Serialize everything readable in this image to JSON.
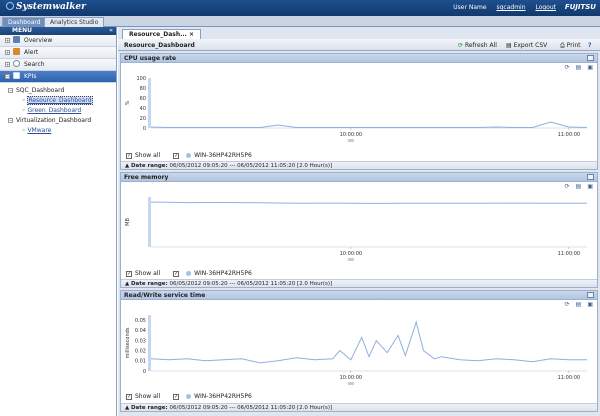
{
  "header": {
    "app_name": "Systemwalker",
    "user_label": "User Name",
    "user_name": "sqcadmin",
    "logout": "Logout",
    "vendor": "FUJITSU"
  },
  "top_tabs": [
    {
      "label": "Dashboard",
      "active": true
    },
    {
      "label": "Analytics Studio",
      "active": false
    }
  ],
  "menu": {
    "title": "MENU",
    "items": [
      {
        "label": "Overview",
        "icon": "overview-icon",
        "color": "#5b7fb5"
      },
      {
        "label": "Alert",
        "icon": "alert-icon",
        "color": "#d9892d"
      },
      {
        "label": "Search",
        "icon": "search-icon",
        "color": "#7a8a9a"
      },
      {
        "label": "KPIs",
        "icon": "kpi-icon",
        "color": "#2c6cc4"
      }
    ],
    "tree": [
      {
        "label": "SQC_Dashboard",
        "level": 1
      },
      {
        "label": "Resource_Dashboard",
        "level": 2,
        "selected": true
      },
      {
        "label": "Green_Dashboard",
        "level": 2
      },
      {
        "label": "Virtualization_Dashboard",
        "level": 1
      },
      {
        "label": "VMware",
        "level": 2
      }
    ]
  },
  "content": {
    "tab_label": "Resource_Dash...",
    "toolbar_title": "Resource_Dashboard",
    "refresh_all": "Refresh All",
    "export_csv": "Export CSV",
    "print": "Print",
    "help": "?"
  },
  "panels": [
    {
      "title": "CPU usage rate",
      "show_all": "Show all",
      "series": "WIN-36HP42RH5P6",
      "date_label": "Date range:",
      "date_value": "06/05/2012 09:05:20 --- 06/05/2012 11:05:20 [2.0 Hour(s)]"
    },
    {
      "title": "Free memory",
      "show_all": "Show all",
      "series": "WIN-36HP42RH5P6",
      "date_label": "Date range:",
      "date_value": "06/05/2012 09:05:20 --- 06/05/2012 11:05:20 [2.0 Hour(s)]"
    },
    {
      "title": "Read/Write service time",
      "show_all": "Show all",
      "series": "WIN-36HP42RH5P6",
      "date_label": "Date range:",
      "date_value": "06/05/2012 09:05:20 --- 06/05/2012 11:05:20 [2.0 Hour(s)]"
    }
  ],
  "chart_data": [
    {
      "type": "line",
      "title": "CPU usage rate",
      "ylabel": "%",
      "ylim": [
        0,
        100
      ],
      "yticks": [
        0,
        20,
        40,
        60,
        80,
        100
      ],
      "xticks": [
        "10:00:00",
        "11:00:00"
      ],
      "x": [
        0,
        5,
        10,
        15,
        20,
        25,
        30,
        35,
        40,
        45,
        50,
        55,
        60,
        65,
        70,
        75,
        80,
        85,
        90,
        95,
        100,
        105,
        110,
        115,
        120
      ],
      "series": [
        {
          "name": "WIN-36HP42RH5P6",
          "values": [
            2,
            1,
            1,
            1,
            1,
            1,
            1,
            6,
            1,
            1,
            1,
            1,
            1,
            1,
            1,
            1,
            1,
            1,
            1,
            2,
            1,
            1,
            12,
            2,
            1
          ]
        }
      ]
    },
    {
      "type": "line",
      "title": "Free memory",
      "ylabel": "MB",
      "ylim": [
        0,
        800
      ],
      "xticks": [
        "10:00:00",
        "11:00:00"
      ],
      "x": [
        0,
        10,
        20,
        30,
        40,
        50,
        60,
        70,
        80,
        90,
        100,
        110,
        120
      ],
      "series": [
        {
          "name": "WIN-36HP42RH5P6",
          "values": [
            720,
            710,
            712,
            708,
            700,
            702,
            698,
            700,
            701,
            699,
            702,
            700,
            700
          ]
        }
      ]
    },
    {
      "type": "line",
      "title": "Read/Write service time",
      "ylabel": "milliseconds",
      "ylim": [
        0,
        0.055
      ],
      "yticks": [
        0,
        0.01,
        0.02,
        0.03,
        0.04,
        0.05
      ],
      "xticks": [
        "10:00:00",
        "11:00:00"
      ],
      "x": [
        0,
        5,
        10,
        15,
        20,
        25,
        30,
        35,
        40,
        45,
        50,
        52,
        55,
        58,
        60,
        62,
        65,
        68,
        70,
        73,
        75,
        78,
        80,
        85,
        90,
        95,
        100,
        105,
        110,
        115,
        120
      ],
      "series": [
        {
          "name": "WIN-36HP42RH5P6",
          "values": [
            0.012,
            0.011,
            0.012,
            0.01,
            0.011,
            0.012,
            0.008,
            0.01,
            0.013,
            0.011,
            0.012,
            0.02,
            0.011,
            0.033,
            0.014,
            0.03,
            0.018,
            0.035,
            0.015,
            0.048,
            0.02,
            0.012,
            0.014,
            0.011,
            0.01,
            0.012,
            0.011,
            0.009,
            0.012,
            0.011,
            0.011
          ]
        }
      ]
    }
  ]
}
